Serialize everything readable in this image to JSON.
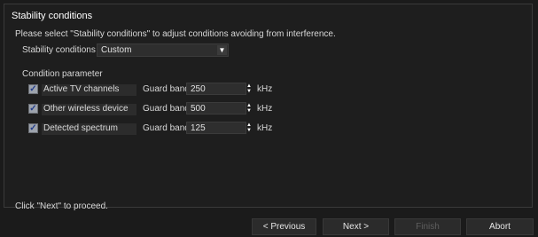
{
  "panel": {
    "title": "Stability conditions",
    "instruction": "Please select \"Stability conditions\" to adjust conditions avoiding from interference.",
    "conditions_label": "Stability conditions",
    "conditions_value": "Custom",
    "section_label": "Condition parameter",
    "rows": [
      {
        "label": "Active TV channels",
        "checked": true,
        "guard_label": "Guard band",
        "value": "250",
        "unit": "kHz"
      },
      {
        "label": "Other wireless device",
        "checked": true,
        "guard_label": "Guard band",
        "value": "500",
        "unit": "kHz"
      },
      {
        "label": "Detected spectrum",
        "checked": true,
        "guard_label": "Guard band",
        "value": "125",
        "unit": "kHz"
      }
    ],
    "footer": "Click \"Next\" to proceed."
  },
  "buttons": {
    "previous": "< Previous",
    "next": "Next >",
    "finish": "Finish",
    "abort": "Abort"
  },
  "icons": {
    "dropdown": "triangle-down-icon",
    "spin": "spin-arrows-icon",
    "check": "checkmark-icon"
  }
}
